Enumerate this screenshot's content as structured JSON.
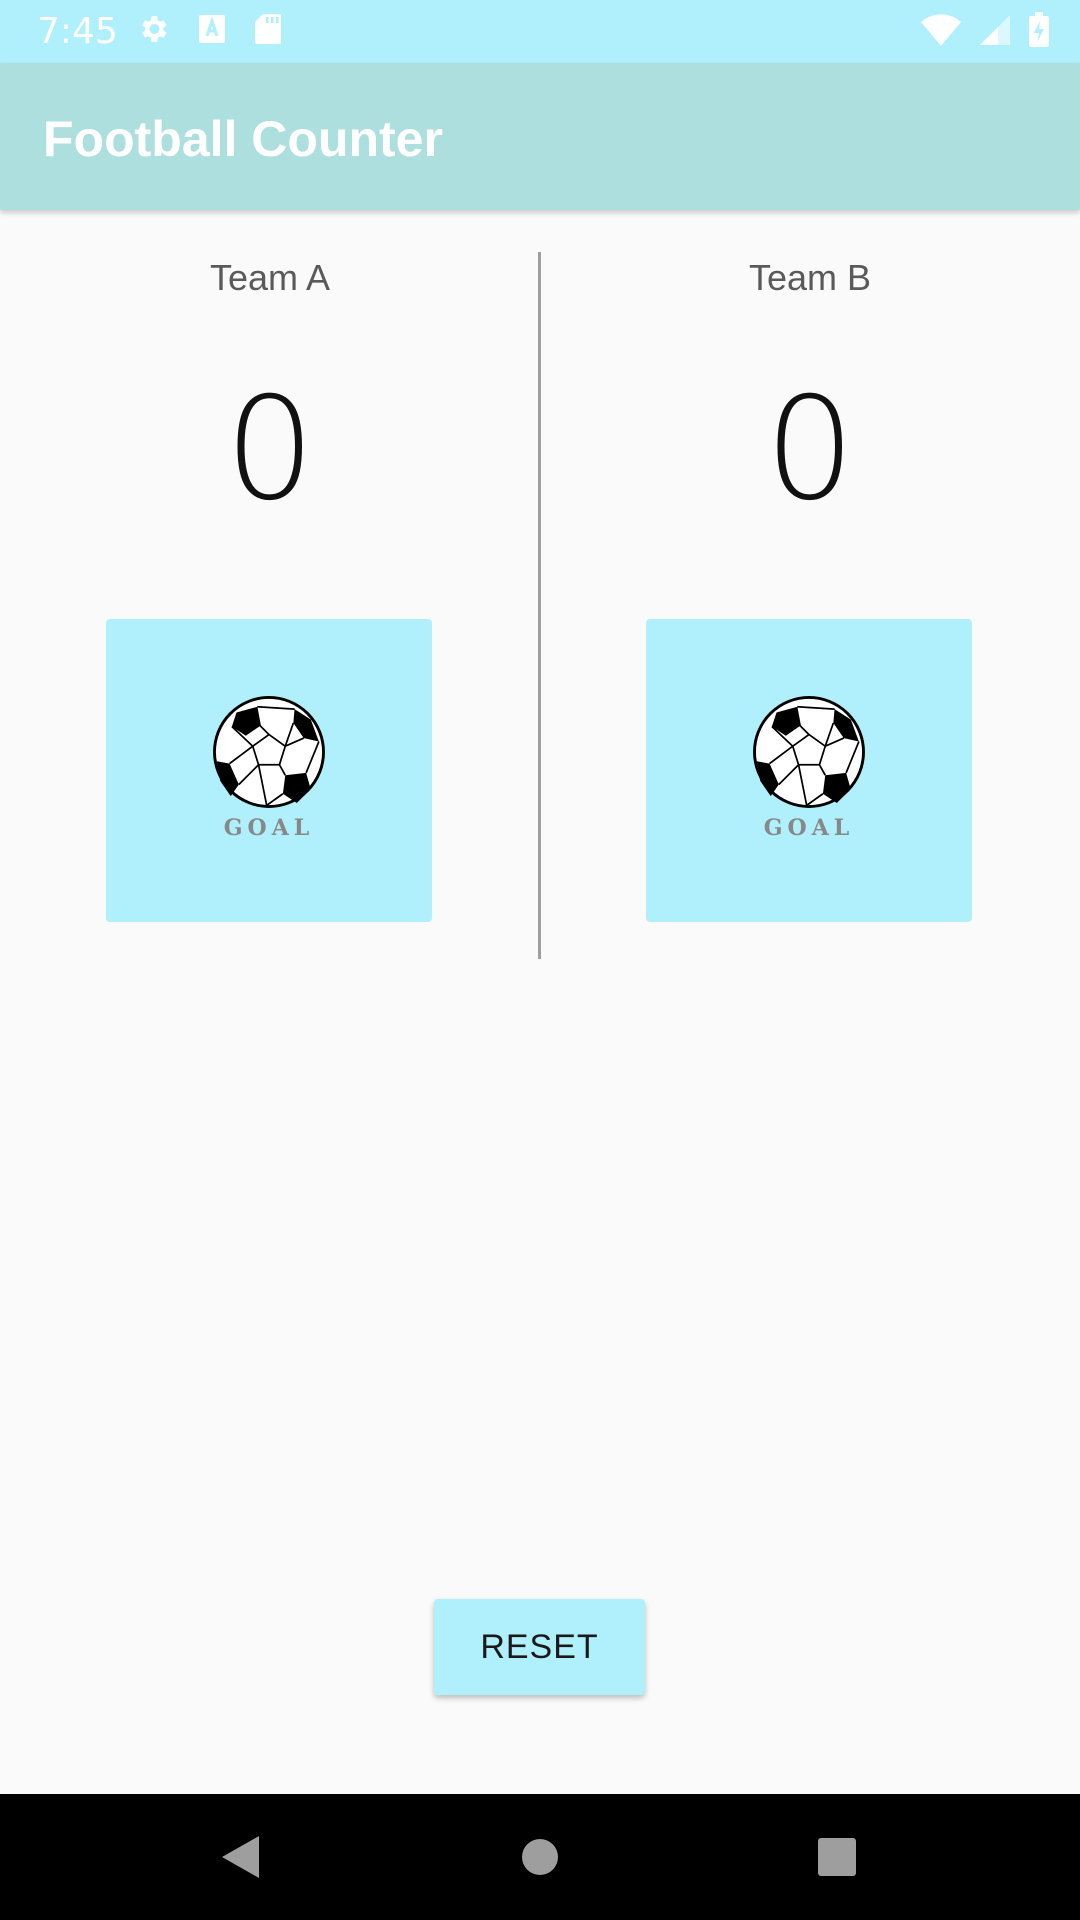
{
  "status_bar": {
    "time": "7:45",
    "left_icons": [
      "settings-icon",
      "keyboard-a-icon",
      "sd-card-icon"
    ],
    "right_icons": [
      "wifi-icon",
      "cell-signal-icon",
      "battery-charging-icon"
    ],
    "background": "#b0f0fd"
  },
  "app_bar": {
    "title": "Football Counter",
    "background": "#addfde"
  },
  "teams": [
    {
      "name": "Team A",
      "score": "0",
      "goal_label": "GOAL",
      "goal_icon": "soccer-ball-icon"
    },
    {
      "name": "Team B",
      "score": "0",
      "goal_label": "GOAL",
      "goal_icon": "soccer-ball-icon"
    }
  ],
  "reset_label": "RESET",
  "accent_color": "#b0f0fd",
  "nav_bar": {
    "buttons": [
      "back-icon",
      "home-icon",
      "recents-icon"
    ]
  }
}
